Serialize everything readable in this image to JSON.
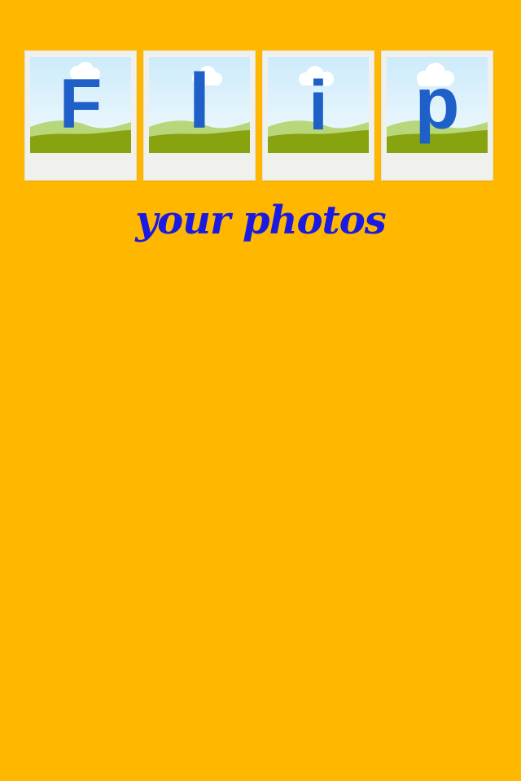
{
  "logo": {
    "letters": [
      "F",
      "l",
      "i",
      "p"
    ]
  },
  "tagline": "your photos",
  "colors": {
    "background": "#FFB700",
    "letter": "#1E5FC8",
    "tagline": "#1A1AE0",
    "frame": "#F0F0EC",
    "sky_top": "#CDEBFA",
    "sky_bottom": "#F2FAFE",
    "hill_light": "#B8D77A",
    "hill_dark": "#88A310"
  }
}
